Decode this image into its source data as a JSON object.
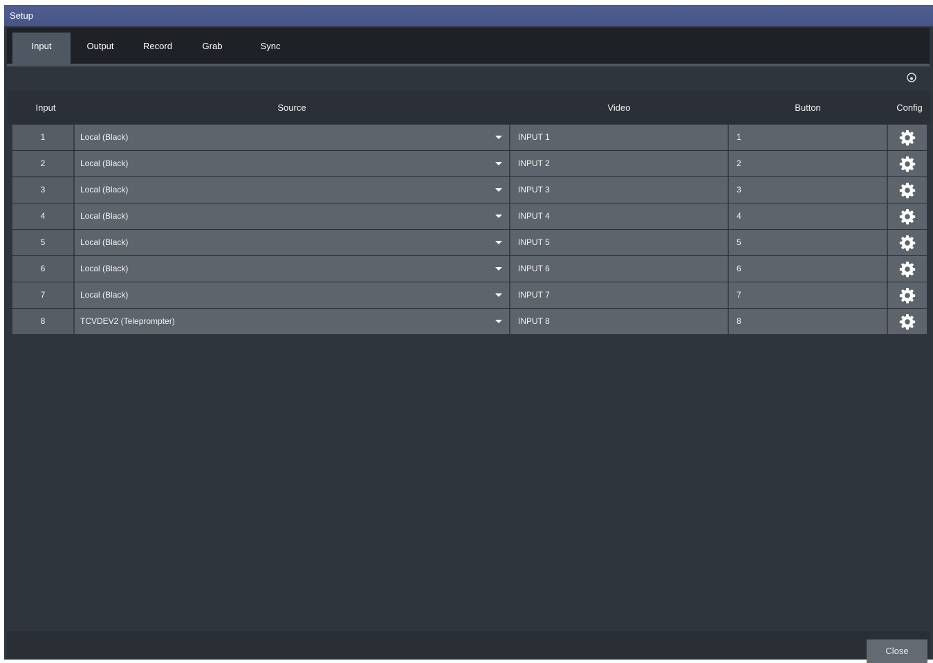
{
  "window": {
    "title": "Setup"
  },
  "tabs": [
    {
      "label": "Input",
      "active": true
    },
    {
      "label": "Output",
      "active": false
    },
    {
      "label": "Record",
      "active": false
    },
    {
      "label": "Grab",
      "active": false
    },
    {
      "label": "Sync",
      "active": false
    }
  ],
  "table": {
    "headers": {
      "input": "Input",
      "source": "Source",
      "video": "Video",
      "button": "Button",
      "config": "Config"
    },
    "rows": [
      {
        "input": "1",
        "source": "Local (Black)",
        "video": "INPUT 1",
        "button": "1"
      },
      {
        "input": "2",
        "source": "Local (Black)",
        "video": "INPUT 2",
        "button": "2"
      },
      {
        "input": "3",
        "source": "Local (Black)",
        "video": "INPUT 3",
        "button": "3"
      },
      {
        "input": "4",
        "source": "Local (Black)",
        "video": "INPUT 4",
        "button": "4"
      },
      {
        "input": "5",
        "source": "Local (Black)",
        "video": "INPUT 5",
        "button": "5"
      },
      {
        "input": "6",
        "source": "Local (Black)",
        "video": "INPUT 6",
        "button": "6"
      },
      {
        "input": "7",
        "source": "Local (Black)",
        "video": "INPUT 7",
        "button": "7"
      },
      {
        "input": "8",
        "source": "TCVDEV2 (Teleprompter)",
        "video": "INPUT 8",
        "button": "8"
      }
    ]
  },
  "footer": {
    "close_label": "Close"
  },
  "icons": {
    "help": "help-icon",
    "config": "gear-icon",
    "dropdown": "chevron-down-icon"
  },
  "colors": {
    "titlebar": "#4f5e90",
    "background": "#2f353d",
    "row": "#5d646c",
    "tab_active": "#4f5862"
  }
}
